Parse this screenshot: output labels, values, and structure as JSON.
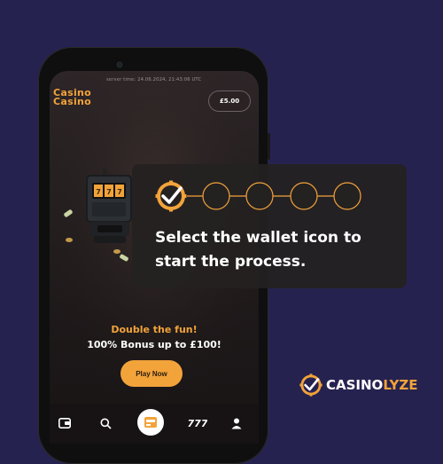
{
  "status_bar": {
    "server_time": "server time: 24.06.2024, 21:43:06 UTC"
  },
  "header": {
    "logo_line1": "Casino",
    "logo_line2": "Casino",
    "balance": "£5.00"
  },
  "promo": {
    "headline": "Double the fun!",
    "bonus": "100% Bonus up to £100!",
    "cta_label": "Play Now"
  },
  "bottom_nav": {
    "items": [
      "wallet-icon",
      "search-icon",
      "casino-games-icon",
      "slots-777-icon",
      "profile-icon"
    ]
  },
  "tutorial": {
    "text": "Select the wallet icon to start the process.",
    "steps_total": 5,
    "step_current": 1
  },
  "brand": {
    "part1": "CASINO",
    "part2": "LYZE"
  },
  "colors": {
    "background": "#262250",
    "accent": "#f2a33a",
    "tooltip": "#242121"
  }
}
